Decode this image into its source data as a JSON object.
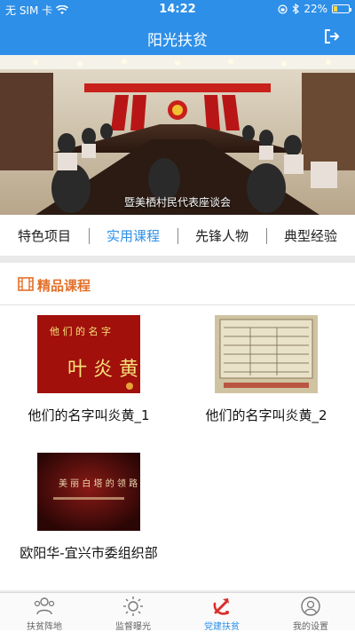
{
  "status_bar": {
    "carrier": "无 SIM 卡",
    "time": "14:22",
    "battery_percent": "22%",
    "battery_level": 0.22
  },
  "header": {
    "title": "阳光扶贫",
    "exit_icon": "logout-icon"
  },
  "banner": {
    "caption": "暨美栖村民代表座谈会"
  },
  "tabs": [
    {
      "label": "特色项目",
      "active": false
    },
    {
      "label": "实用课程",
      "active": true
    },
    {
      "label": "先锋人物",
      "active": false
    },
    {
      "label": "典型经验",
      "active": false
    }
  ],
  "section": {
    "title": "精品课程",
    "icon": "film-icon"
  },
  "courses": [
    {
      "name": "他们的名字叫炎黄_1"
    },
    {
      "name": "他们的名字叫炎黄_2"
    },
    {
      "name": "欧阳华-宜兴市委组织部"
    }
  ],
  "tabbar": [
    {
      "label": "扶贫阵地",
      "icon": "people-icon",
      "active": false
    },
    {
      "label": "监督曝光",
      "icon": "sun-icon",
      "active": false
    },
    {
      "label": "党建扶贫",
      "icon": "party-emblem-icon",
      "active": true
    },
    {
      "label": "我的设置",
      "icon": "user-icon",
      "active": false
    }
  ],
  "colors": {
    "primary": "#2d8fe8",
    "section_accent": "#e2702a",
    "active_tab": "#d9302b"
  }
}
